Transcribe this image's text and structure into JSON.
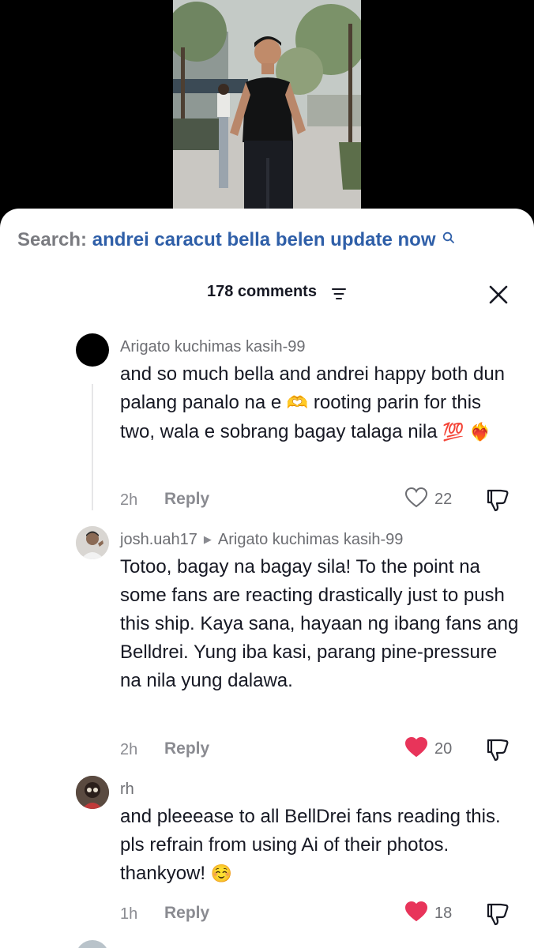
{
  "search": {
    "prefix": "Search:",
    "query": "andrei caracut bella belen update now"
  },
  "header": {
    "comment_count": "178 comments"
  },
  "comments": [
    {
      "username": "Arigato kuchimas kasih-99",
      "text_parts": [
        "and so much bella and andrei happy both dun palang panalo na e ",
        "🫶",
        " rooting parin for this two, wala e sobrang bagay talaga nila ",
        "💯",
        " ",
        "❤️‍🔥"
      ],
      "time": "2h",
      "reply_label": "Reply",
      "likes": "22",
      "liked": false
    },
    {
      "username": "josh.uah17",
      "reply_to": "Arigato kuchimas kasih-99",
      "text": "Totoo, bagay na bagay sila! To the point na some fans are reacting drastically just to push this ship. Kaya sana, hayaan ng ibang fans ang Belldrei. Yung iba kasi, parang pine-pressure na nila yung dalawa.",
      "time": "2h",
      "reply_label": "Reply",
      "likes": "20",
      "liked": true
    },
    {
      "username": "rh",
      "text_parts": [
        "and pleeease to all BellDrei fans reading this. pls refrain from using Ai of their photos. thankyow! ",
        "☺️"
      ],
      "time": "1h",
      "reply_label": "Reply",
      "likes": "18",
      "liked": true
    }
  ],
  "colors": {
    "like_active": "#e8345a",
    "link_blue": "#2f5fa8",
    "muted": "#8a8b91"
  },
  "icons": [
    "search-icon",
    "filter-icon",
    "close-icon",
    "heart-icon",
    "dislike-icon"
  ]
}
